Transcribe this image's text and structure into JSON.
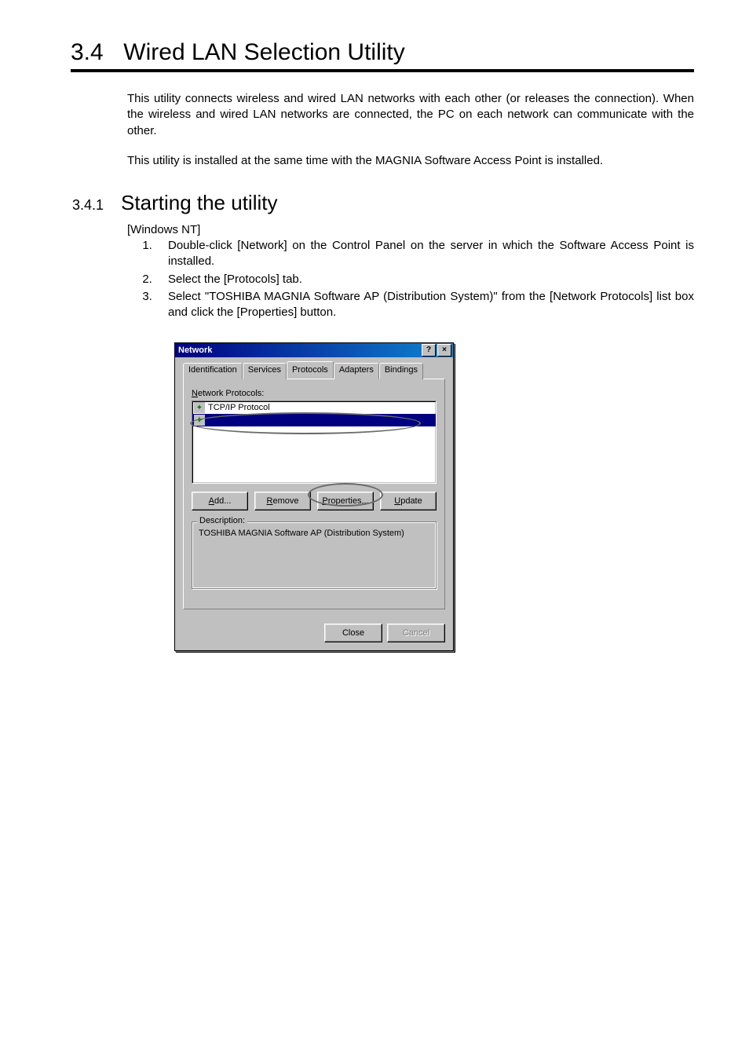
{
  "heading": {
    "number": "3.4",
    "title": "Wired LAN Selection Utility"
  },
  "para1": "This utility connects wireless and wired LAN networks with each other (or releases the connection).  When the wireless and wired LAN networks are connected, the PC on each network can communicate with the other.",
  "para2": "This utility is installed at the same time with the MAGNIA Software Access Point is installed.",
  "subsection": {
    "number": "3.4.1",
    "title": "Starting the utility"
  },
  "platform": "[Windows NT]",
  "steps": [
    "Double-click [Network] on the Control Panel on the server in which the Software Access Point is installed.",
    "Select the [Protocols] tab.",
    "Select \"TOSHIBA MAGNIA Software AP (Distribution System)\" from the [Network Protocols] list box and click the [Properties] button."
  ],
  "dialog": {
    "title": "Network",
    "help_glyph": "?",
    "close_glyph": "×",
    "tabs": {
      "identification": "Identification",
      "services": "Services",
      "protocols": "Protocols",
      "adapters": "Adapters",
      "bindings": "Bindings"
    },
    "list_label_pre": "N",
    "list_label_rest": "etwork Protocols:",
    "items": {
      "tcpip": "TCP/IP Protocol",
      "selected_blank": " "
    },
    "buttons": {
      "add_u": "A",
      "add_rest": "dd...",
      "remove_u": "R",
      "remove_rest": "emove",
      "properties_u": "P",
      "properties_rest": "roperties...",
      "update_u": "U",
      "update_rest": "pdate"
    },
    "group_label": "Description:",
    "description": "TOSHIBA MAGNIA Software AP (Distribution System)",
    "footer": {
      "close": "Close",
      "cancel": "Cancel"
    }
  }
}
